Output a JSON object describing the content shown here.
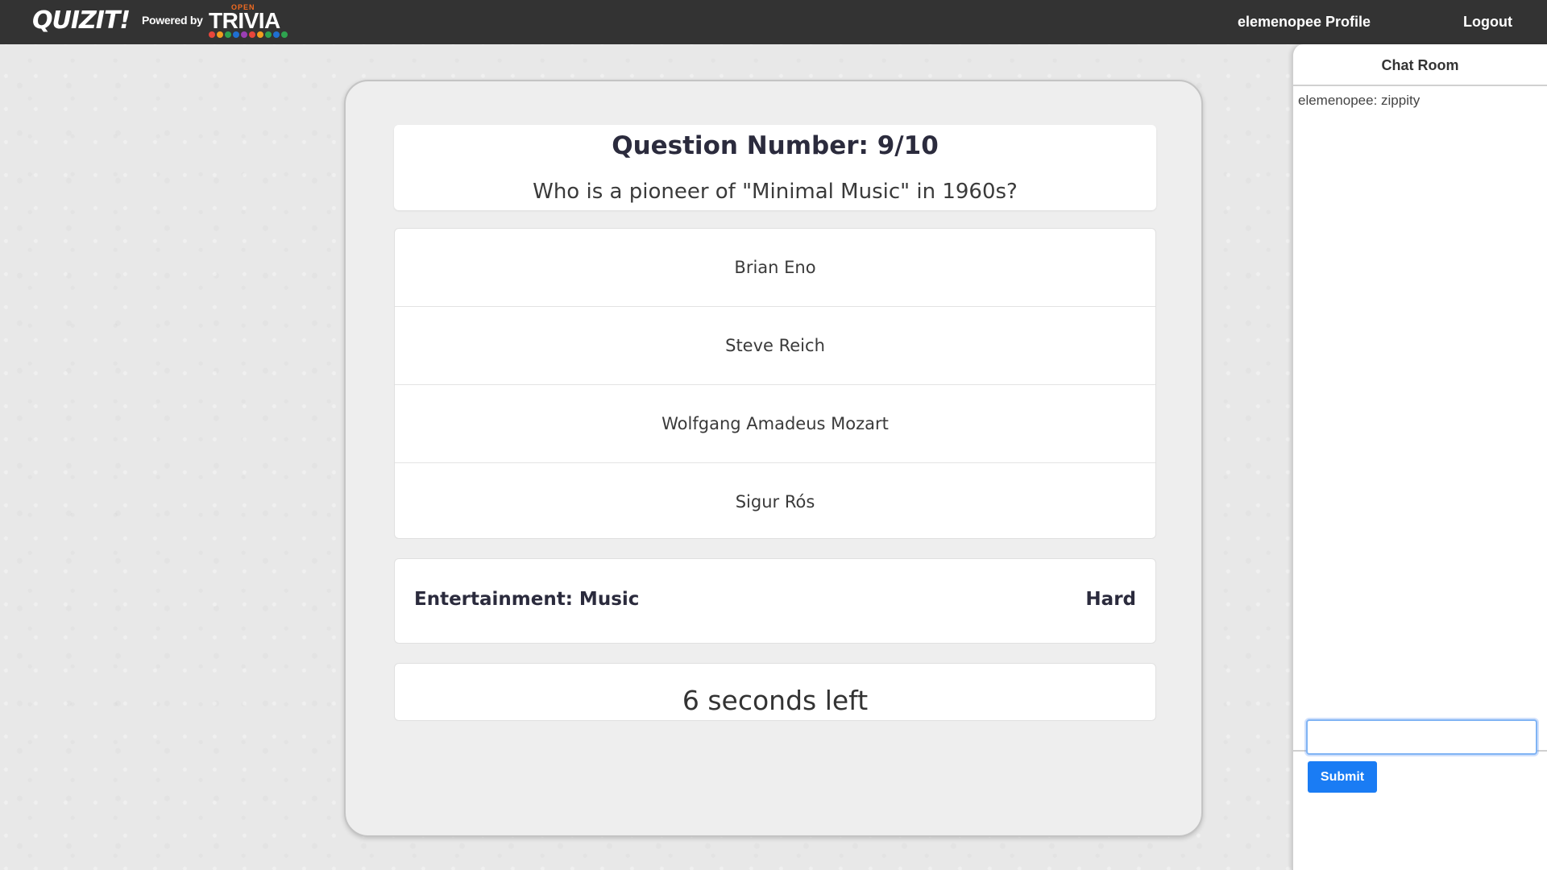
{
  "navbar": {
    "logo": "QUIZIT!",
    "powered_by": "Powered by",
    "trivia_logo": {
      "small_word": "OPEN",
      "word": "TRIVIA",
      "dot_colors": [
        "#e8463b",
        "#f29d1f",
        "#2ea34f",
        "#1f6fd1",
        "#9b3fb4",
        "#e8463b",
        "#f29d1f",
        "#2ea34f",
        "#1f6fd1",
        "#2ea34f"
      ]
    },
    "profile_link": "elemenopee Profile",
    "logout_link": "Logout"
  },
  "quiz": {
    "question_number": "Question Number: 9/10",
    "question_text": "Who is a pioneer of \"Minimal Music\" in 1960s?",
    "answers": [
      "Brian Eno",
      "Steve Reich",
      "Wolfgang Amadeus Mozart",
      "Sigur Rós"
    ],
    "category": "Entertainment: Music",
    "difficulty": "Hard",
    "timer": "6 seconds left"
  },
  "chat": {
    "title": "Chat Room",
    "messages": [
      "elemenopee: zippity"
    ],
    "input_value": "",
    "submit_label": "Submit"
  },
  "colors": {
    "navbar_bg": "#333333",
    "submit_button": "#1a7cf4",
    "trivia_open": "#f26b21"
  }
}
